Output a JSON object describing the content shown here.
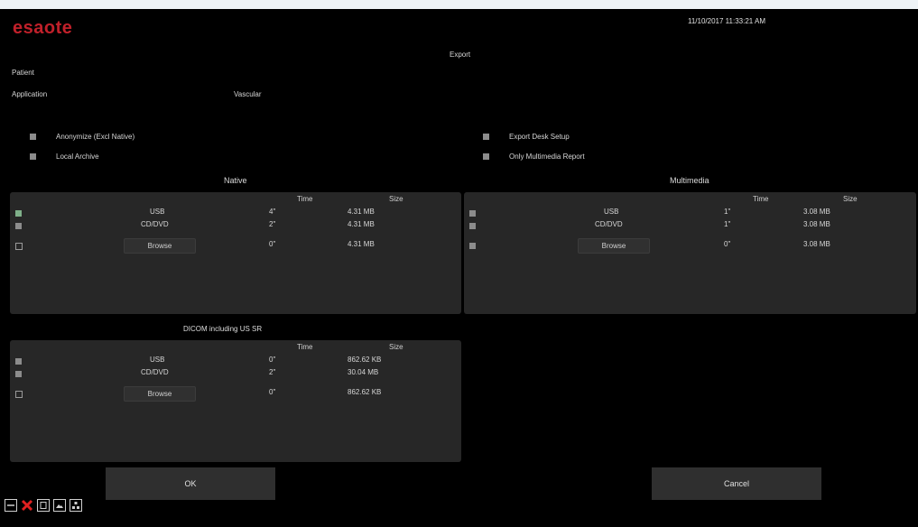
{
  "header": {
    "brand": "esaote",
    "datetime": "11/10/2017 11:33:21 AM",
    "title": "Export"
  },
  "info": {
    "patient_label": "Patient",
    "application_label": "Application",
    "application_value": "Vascular"
  },
  "options": {
    "anonymize": "Anonymize (Excl Native)",
    "local_archive": "Local Archive",
    "export_desk_setup": "Export Desk Setup",
    "only_multimedia_report": "Only Multimedia Report"
  },
  "native": {
    "title": "Native",
    "time_header": "Time",
    "size_header": "Size",
    "rows": [
      {
        "dest": "USB",
        "time": "4\"",
        "size": "4.31 MB"
      },
      {
        "dest": "CD/DVD",
        "time": "2\"",
        "size": "4.31 MB"
      },
      {
        "dest": "Browse",
        "time": "0\"",
        "size": "4.31 MB"
      }
    ]
  },
  "multimedia": {
    "title": "Multimedia",
    "time_header": "Time",
    "size_header": "Size",
    "rows": [
      {
        "dest": "USB",
        "time": "1\"",
        "size": "3.08 MB"
      },
      {
        "dest": "CD/DVD",
        "time": "1\"",
        "size": "3.08 MB"
      },
      {
        "dest": "Browse",
        "time": "0\"",
        "size": "3.08 MB"
      }
    ]
  },
  "dicom": {
    "title": "DICOM including US SR",
    "time_header": "Time",
    "size_header": "Size",
    "rows": [
      {
        "dest": "USB",
        "time": "0\"",
        "size": "862.62 KB"
      },
      {
        "dest": "CD/DVD",
        "time": "2\"",
        "size": "30.04 MB"
      },
      {
        "dest": "Browse",
        "time": "0\"",
        "size": "862.62 KB"
      }
    ]
  },
  "buttons": {
    "ok": "OK",
    "cancel": "Cancel"
  },
  "toolbar_icons": [
    "minimize-icon",
    "close-icon",
    "document-icon",
    "image-icon",
    "network-icon"
  ],
  "colors": {
    "brand": "#c0202a",
    "checkbox_on": "#7fb08a",
    "checkbox_off": "#8c8c8c",
    "panel": "#272727"
  }
}
